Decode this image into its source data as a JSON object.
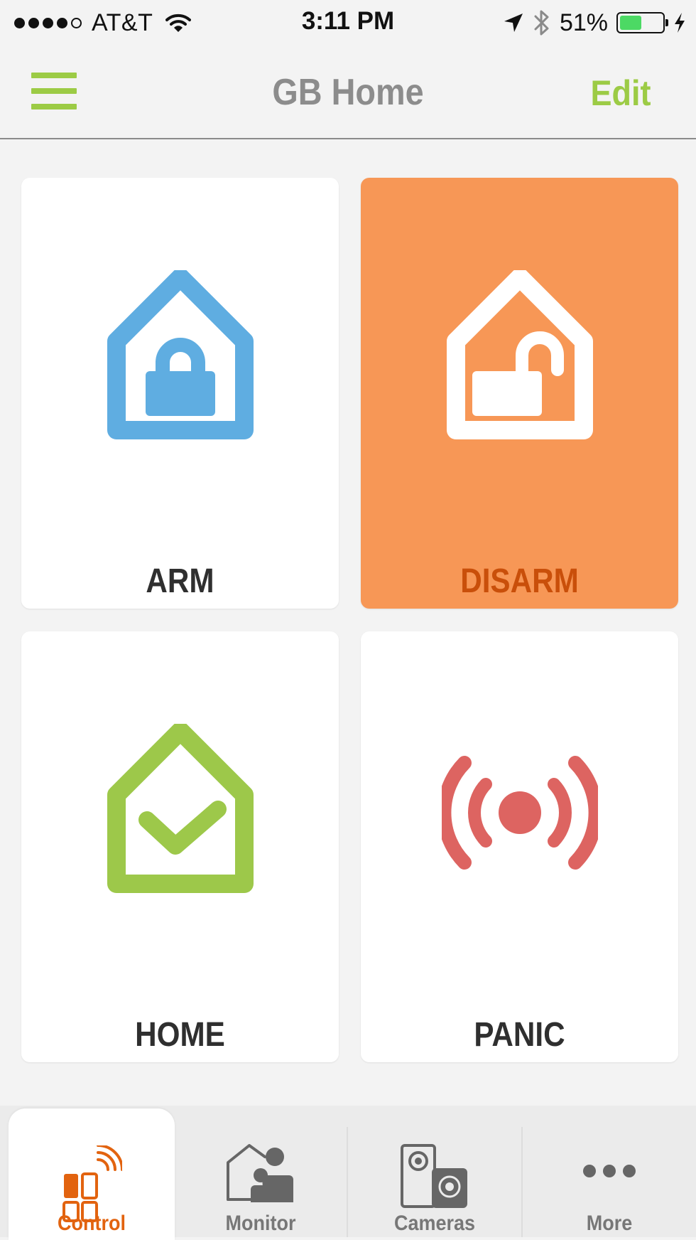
{
  "status_bar": {
    "carrier": "AT&T",
    "time": "3:11 PM",
    "battery_percent": "51%",
    "battery_level": 0.51,
    "signal_bars_filled": 4,
    "signal_bars_total": 5,
    "battery_color": "#4cd964"
  },
  "nav": {
    "title": "GB Home",
    "edit_label": "Edit",
    "menu_icon": "hamburger-menu-icon",
    "accent_color": "#9ccb45"
  },
  "tiles": [
    {
      "label": "ARM",
      "icon": "house-lock-icon",
      "color": "#5fade1",
      "active": false
    },
    {
      "label": "DISARM",
      "icon": "house-unlock-icon",
      "color": "#f79756",
      "active": true
    },
    {
      "label": "HOME",
      "icon": "house-check-icon",
      "color": "#9dc84a",
      "active": false
    },
    {
      "label": "PANIC",
      "icon": "alarm-signal-icon",
      "color": "#dd6461",
      "active": false
    }
  ],
  "tabs": [
    {
      "label": "Control",
      "icon": "control-panel-icon",
      "selected": true
    },
    {
      "label": "Monitor",
      "icon": "monitor-people-icon",
      "selected": false
    },
    {
      "label": "Cameras",
      "icon": "cameras-icon",
      "selected": false
    },
    {
      "label": "More",
      "icon": "more-dots-icon",
      "selected": false
    }
  ],
  "tab_selected_color": "#e2630f"
}
